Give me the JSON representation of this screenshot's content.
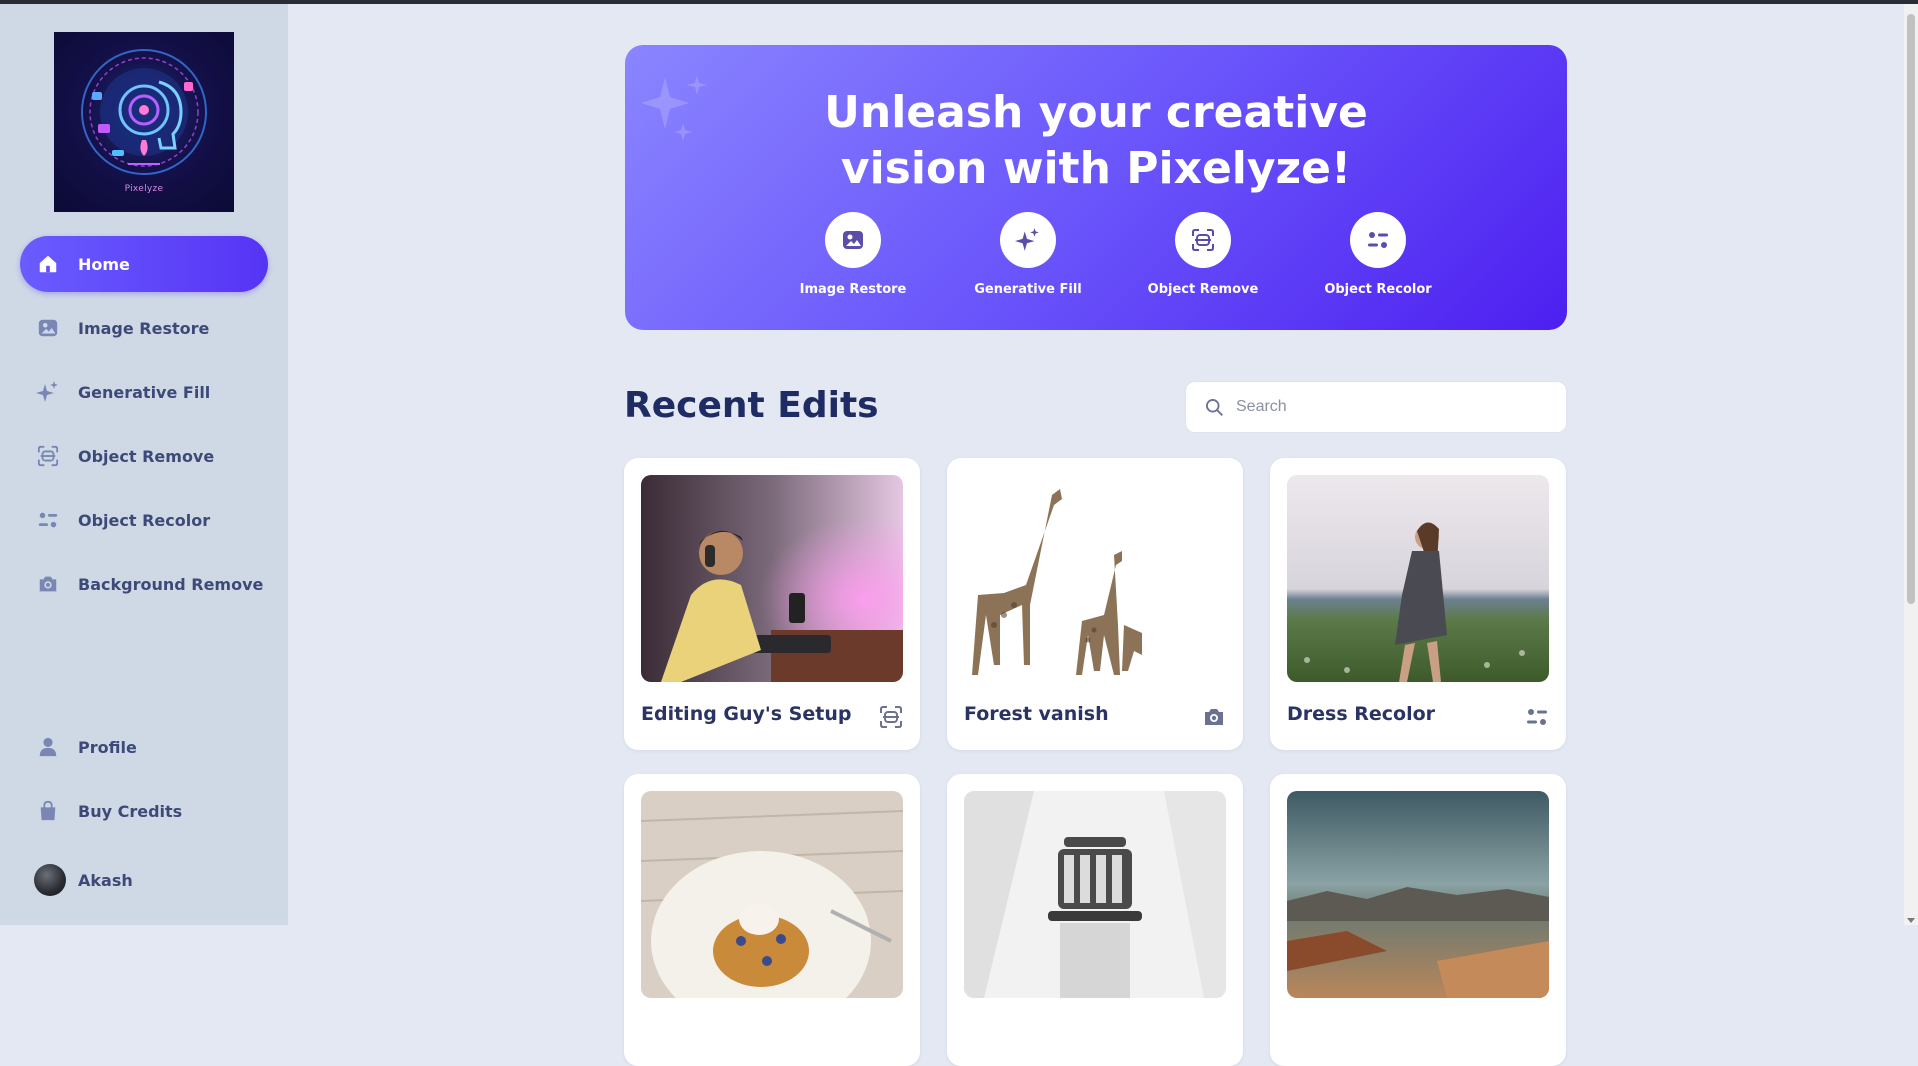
{
  "app": {
    "logo_text": "Pixelyze"
  },
  "sidebar": {
    "items": [
      {
        "label": "Home",
        "icon": "home-icon",
        "active": true
      },
      {
        "label": "Image Restore",
        "icon": "image-icon"
      },
      {
        "label": "Generative Fill",
        "icon": "sparkles-icon"
      },
      {
        "label": "Object Remove",
        "icon": "scan-icon"
      },
      {
        "label": "Object Recolor",
        "icon": "sliders-icon"
      },
      {
        "label": "Background Remove",
        "icon": "camera-icon"
      }
    ],
    "bottom": [
      {
        "label": "Profile",
        "icon": "user-icon"
      },
      {
        "label": "Buy Credits",
        "icon": "bag-icon"
      }
    ],
    "user": {
      "name": "Akash"
    }
  },
  "hero": {
    "title_line1": "Unleash your creative",
    "title_line2": "vision with Pixelyze!",
    "tools": [
      {
        "label": "Image Restore",
        "icon": "image-icon"
      },
      {
        "label": "Generative Fill",
        "icon": "sparkles-icon"
      },
      {
        "label": "Object Remove",
        "icon": "scan-icon"
      },
      {
        "label": "Object Recolor",
        "icon": "sliders-icon"
      }
    ]
  },
  "recent": {
    "title": "Recent Edits",
    "search_placeholder": "Search",
    "cards": [
      {
        "title": "Editing Guy's Setup",
        "icon": "scan-icon"
      },
      {
        "title": "Forest vanish",
        "icon": "camera-icon"
      },
      {
        "title": "Dress Recolor",
        "icon": "sliders-icon"
      },
      {
        "title": "",
        "icon": ""
      },
      {
        "title": "",
        "icon": ""
      },
      {
        "title": "",
        "icon": ""
      }
    ]
  },
  "colors": {
    "accent": "#5b3cf6",
    "sidebar_bg": "#cfd9e6",
    "page_bg": "#e3e8f2",
    "heading": "#1f2c63"
  }
}
